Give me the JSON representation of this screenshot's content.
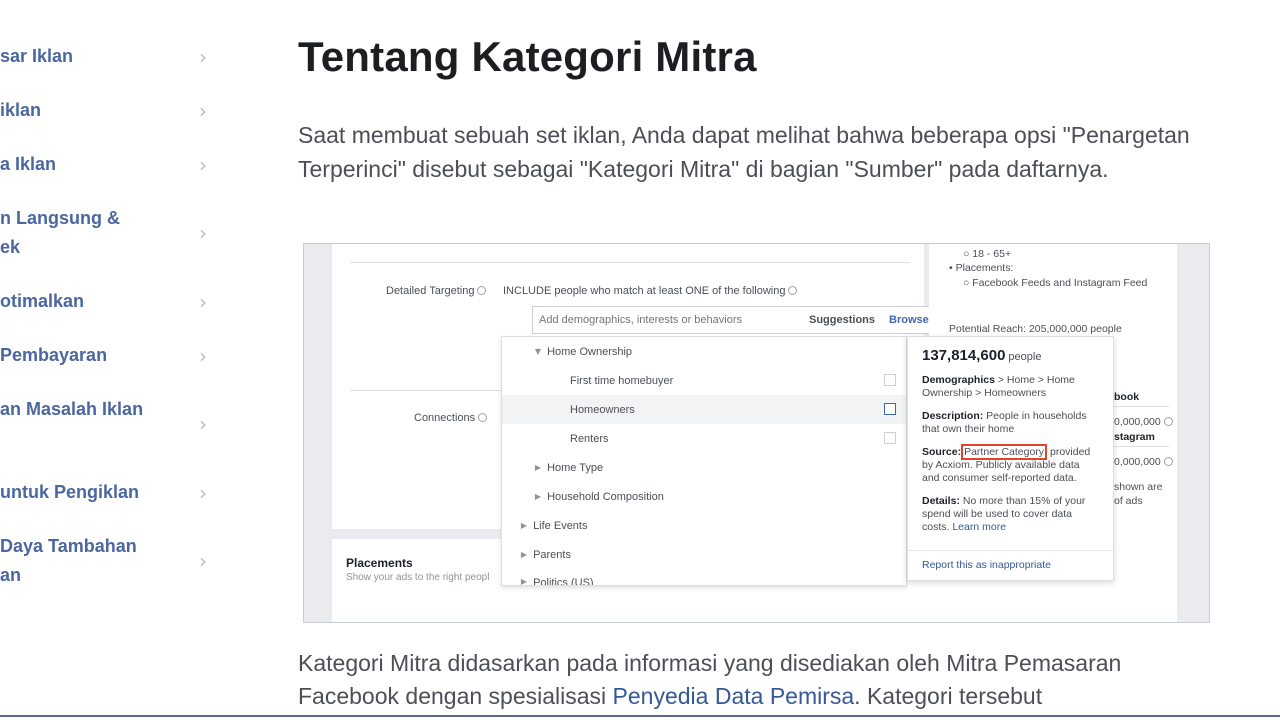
{
  "sidebar": {
    "items": [
      {
        "label": "sar Iklan"
      },
      {
        "label": "iklan"
      },
      {
        "label": "a Iklan"
      },
      {
        "label": "n Langsung &\nek"
      },
      {
        "label": "otimalkan"
      },
      {
        "label": "Pembayaran"
      },
      {
        "label": "an Masalah Iklan"
      },
      {
        "label": "untuk Pengiklan"
      },
      {
        "label": "Daya Tambahan\nan"
      }
    ],
    "chevron": "›"
  },
  "main": {
    "title": "Tentang Kategori Mitra",
    "intro": "Saat membuat sebuah set iklan, Anda dapat melihat bahwa beberapa opsi \"Penargetan Terperinci\" disebut sebagai \"Kategori Mitra\" di bagian \"Sumber\" pada daftarnya.",
    "para2_before": "Kategori Mitra didasarkan pada informasi yang disediakan oleh Mitra Pemasaran Facebook dengan spesialisasi ",
    "para2_link": "Penyedia Data Pemirsa",
    "para2_after": ". Kategori tersebut"
  },
  "figure": {
    "detailed_targeting_label": "Detailed Targeting",
    "include_text": "INCLUDE people who match at least ONE of the following",
    "search_placeholder": "Add demographics, interests or behaviors",
    "tab_suggestions": "Suggestions",
    "tab_browse": "Browse",
    "connections_label": "Connections",
    "placements_title": "Placements",
    "placements_sub": "Show your ads to the right peopl",
    "rows": [
      {
        "label": "Home Ownership"
      },
      {
        "label": "First time homebuyer"
      },
      {
        "label": "Homeowners"
      },
      {
        "label": "Renters"
      },
      {
        "label": "Home Type"
      },
      {
        "label": "Household Composition"
      },
      {
        "label": "Life Events"
      },
      {
        "label": "Parents"
      },
      {
        "label": "Politics (US)"
      }
    ],
    "tooltip": {
      "count": "137,814,600",
      "count_unit": "people",
      "demographics_label": "Demographics",
      "demographics_text": " > Home > Home Ownership > Homeowners",
      "description_label": "Description:",
      "description_text": " People in households that own their home",
      "source_label": "Source:",
      "source_link": "Partner Category",
      "source_text": " provided by Acxiom. Publicly available data and consumer self-reported data.",
      "details_label": "Details:",
      "details_text": " No more than 15% of your spend will be used to cover data costs. ",
      "learn_more": "Learn more",
      "report": "Report this as inappropriate"
    },
    "right": {
      "age": "18 - 65+",
      "placements": "Placements:",
      "feeds": "Facebook Feeds and Instagram Feed",
      "reach": "Potential Reach: 205,000,000 people",
      "book": "book",
      "value1": "0,000,000",
      "stagram": "stagram",
      "value2": "0,000,000",
      "shown1": "shown are",
      "shown2": "of ads"
    }
  }
}
